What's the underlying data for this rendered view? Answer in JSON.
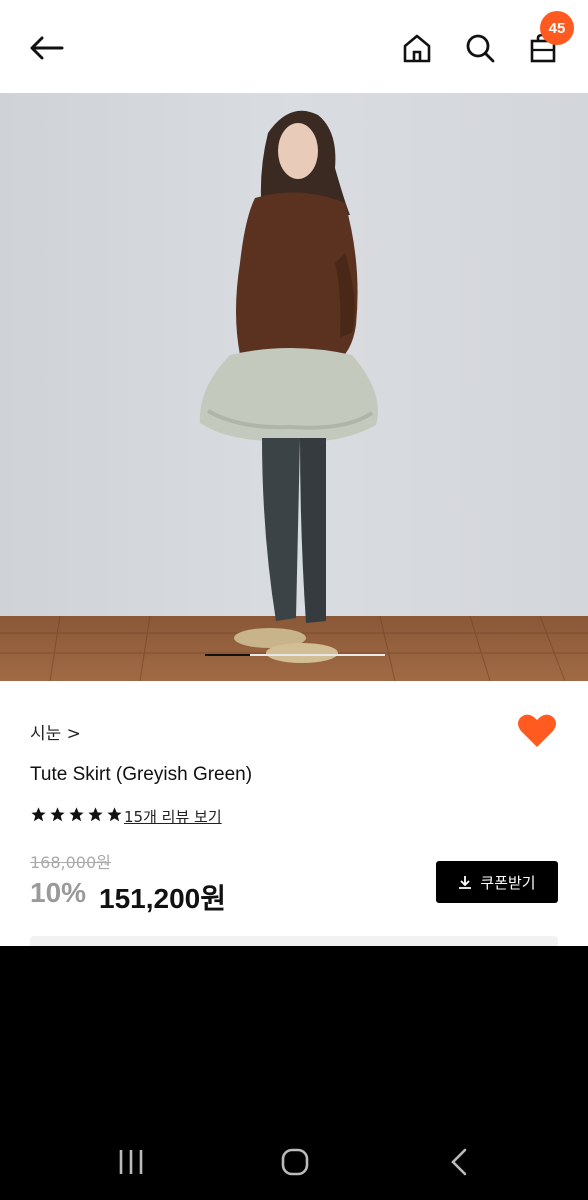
{
  "header": {
    "cart_badge": "45",
    "icons": [
      "back-arrow-icon",
      "home-icon",
      "search-icon",
      "shopping-bag-icon"
    ]
  },
  "product": {
    "brand": "시눈 >",
    "title": "Tute Skirt (Greyish Green)",
    "rating_stars": 5,
    "review_link": "15개 리뷰 보기",
    "original_price": "168,000원",
    "discount": "10%",
    "sale_price": "151,200원",
    "coupon_label": "쿠폰받기",
    "wishlisted": true
  },
  "carousel": {
    "current_fraction": 0.25
  },
  "colors": {
    "accent": "#ff5a1f",
    "black": "#000000"
  }
}
